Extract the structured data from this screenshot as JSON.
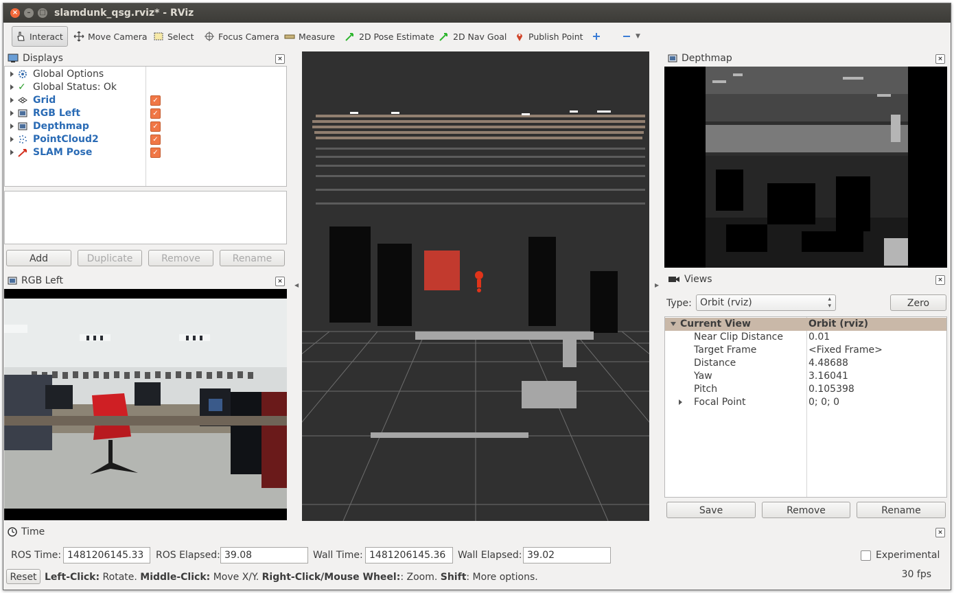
{
  "window": {
    "title": "slamdunk_qsg.rviz* - RViz"
  },
  "toolbar": {
    "interact": "Interact",
    "move_camera": "Move Camera",
    "select": "Select",
    "focus_camera": "Focus Camera",
    "measure": "Measure",
    "pose_estimate": "2D Pose Estimate",
    "nav_goal": "2D Nav Goal",
    "publish_point": "Publish Point"
  },
  "displays": {
    "title": "Displays",
    "items": [
      {
        "label": "Global Options",
        "checked": false
      },
      {
        "label": "Global Status: Ok",
        "checked": false
      },
      {
        "label": "Grid",
        "checked": true
      },
      {
        "label": "RGB Left",
        "checked": true
      },
      {
        "label": "Depthmap",
        "checked": true
      },
      {
        "label": "PointCloud2",
        "checked": true
      },
      {
        "label": "SLAM Pose",
        "checked": true
      }
    ],
    "buttons": {
      "add": "Add",
      "duplicate": "Duplicate",
      "remove": "Remove",
      "rename": "Rename"
    }
  },
  "rgb_left": {
    "title": "RGB Left"
  },
  "depthmap": {
    "title": "Depthmap"
  },
  "views": {
    "title": "Views",
    "type_label": "Type:",
    "type_value": "Orbit (rviz)",
    "zero_label": "Zero",
    "rows": [
      {
        "name": "Current View",
        "value": "Orbit (rviz)"
      },
      {
        "name": "Near Clip Distance",
        "value": "0.01"
      },
      {
        "name": "Target Frame",
        "value": "<Fixed Frame>"
      },
      {
        "name": "Distance",
        "value": "4.48688"
      },
      {
        "name": "Yaw",
        "value": "3.16041"
      },
      {
        "name": "Pitch",
        "value": "0.105398"
      },
      {
        "name": "Focal Point",
        "value": "0; 0; 0"
      }
    ],
    "buttons": {
      "save": "Save",
      "remove": "Remove",
      "rename": "Rename"
    }
  },
  "time": {
    "title": "Time",
    "ros_time_label": "ROS Time:",
    "ros_time": "1481206145.33",
    "ros_elapsed_label": "ROS Elapsed:",
    "ros_elapsed": "39.08",
    "wall_time_label": "Wall Time:",
    "wall_time": "1481206145.36",
    "wall_elapsed_label": "Wall Elapsed:",
    "wall_elapsed": "39.02",
    "experimental_label": "Experimental"
  },
  "statusbar": {
    "reset": "Reset",
    "lc": "Left-Click:",
    "lc_text": " Rotate. ",
    "mc": "Middle-Click:",
    "mc_text": " Move X/Y. ",
    "rc": "Right-Click/Mouse Wheel:",
    "rc_text": ": Zoom. ",
    "shift": "Shift",
    "shift_text": ": More options.",
    "fps": "30 fps"
  }
}
